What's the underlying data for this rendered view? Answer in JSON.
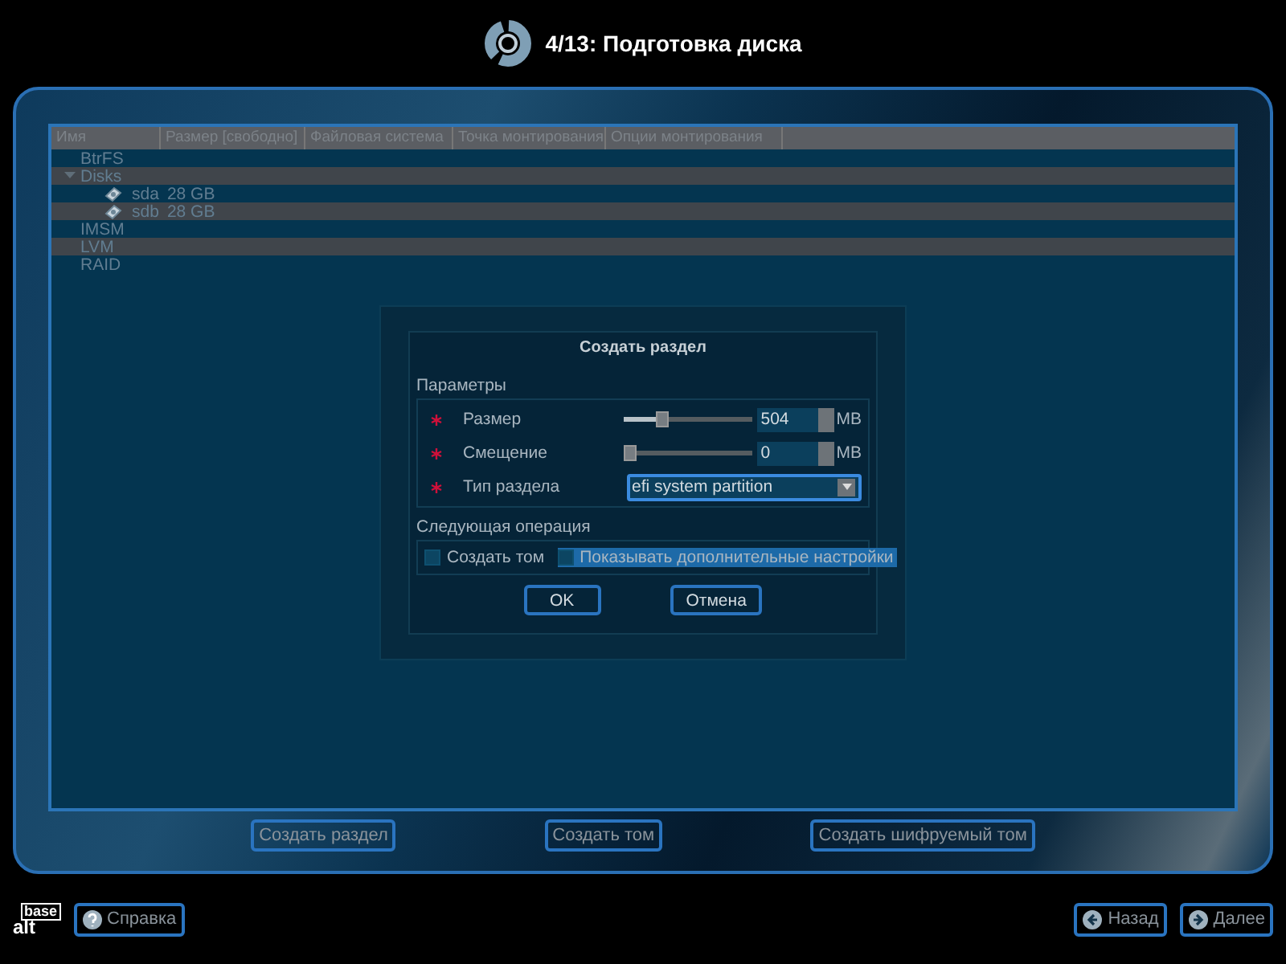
{
  "header": {
    "title": "4/13: Подготовка диска"
  },
  "table": {
    "columns": [
      "Имя",
      "Размер [свободно]",
      "Файловая система",
      "Точка монтирования",
      "Опции монтирования"
    ],
    "rows": [
      {
        "name": "BtrFS",
        "expanded": false,
        "children": []
      },
      {
        "name": "Disks",
        "expanded": true,
        "children": [
          {
            "name": "sda",
            "size": "28 GB"
          },
          {
            "name": "sdb",
            "size": "28 GB"
          }
        ]
      },
      {
        "name": "IMSM",
        "expanded": false,
        "children": []
      },
      {
        "name": "LVM",
        "expanded": false,
        "children": []
      },
      {
        "name": "RAID",
        "expanded": false,
        "children": []
      }
    ]
  },
  "actions": [
    "Создать раздел",
    "Создать том",
    "Создать шифруемый том"
  ],
  "dialog": {
    "title": "Создать раздел",
    "params_label": "Параметры",
    "fields": [
      {
        "kind": "slider",
        "label": "Размер",
        "level": 0.28,
        "value": "504",
        "unit": "MB"
      },
      {
        "kind": "slider",
        "label": "Смещение",
        "level": 0,
        "value": "0",
        "unit": "MB"
      },
      {
        "kind": "select",
        "label": "Тип раздела",
        "value": "efi system partition"
      }
    ],
    "next_label": "Следующая операция",
    "options": [
      {
        "label": "Создать том",
        "checked": false,
        "focused": false
      },
      {
        "label": "Показывать дополнительные настройки",
        "checked": false,
        "focused": true
      }
    ],
    "buttons": [
      "OK",
      "Отмена"
    ]
  },
  "logo": {
    "top": "base",
    "bottom": "alt"
  },
  "footer": {
    "help": "Справка",
    "back": "Назад",
    "next": "Далее"
  }
}
